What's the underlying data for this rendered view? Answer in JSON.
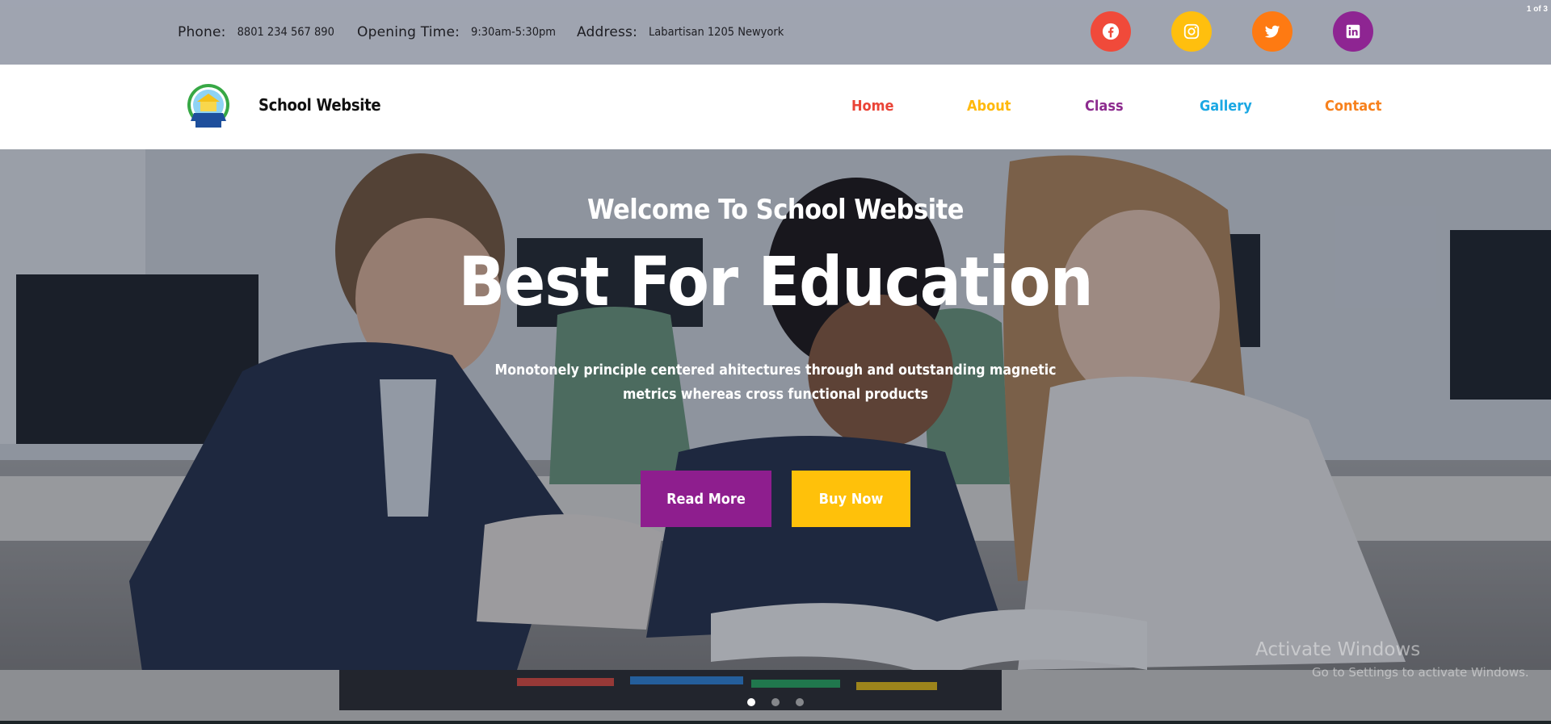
{
  "page_counter": "1 of 3",
  "topbar": {
    "phone": {
      "label": "Phone:",
      "value": "8801 234 567 890"
    },
    "opening": {
      "label": "Opening Time:",
      "value": "9:30am-5:30pm"
    },
    "address": {
      "label": "Address:",
      "value": "Labartisan 1205 Newyork"
    },
    "socials": [
      {
        "icon": "facebook-icon",
        "color": "#f04a3a"
      },
      {
        "icon": "instagram-icon",
        "color": "#ffbf0e"
      },
      {
        "icon": "twitter-icon",
        "color": "#fe7a12"
      },
      {
        "icon": "linkedin-icon",
        "color": "#8e2592"
      }
    ]
  },
  "navbar": {
    "site_name": "School Website",
    "items": [
      {
        "label": "Home",
        "color": "#ea4437"
      },
      {
        "label": "About",
        "color": "#ffb90c"
      },
      {
        "label": "Class",
        "color": "#8d2c8f"
      },
      {
        "label": "Gallery",
        "color": "#1ba8e4"
      },
      {
        "label": "Contact",
        "color": "#f7811d"
      }
    ]
  },
  "hero": {
    "subtitle": "Welcome To School Website",
    "title": "Best For Education",
    "description": "Monotonely principle centered ahitectures through and outstanding magnetic metrics whereas cross functional products",
    "buttons": {
      "read_more": "Read More",
      "buy_now": "Buy Now"
    },
    "slides": 3,
    "active_slide": 1
  },
  "watermark": {
    "line1": "Activate Windows",
    "line2": "Go to Settings to activate Windows."
  }
}
